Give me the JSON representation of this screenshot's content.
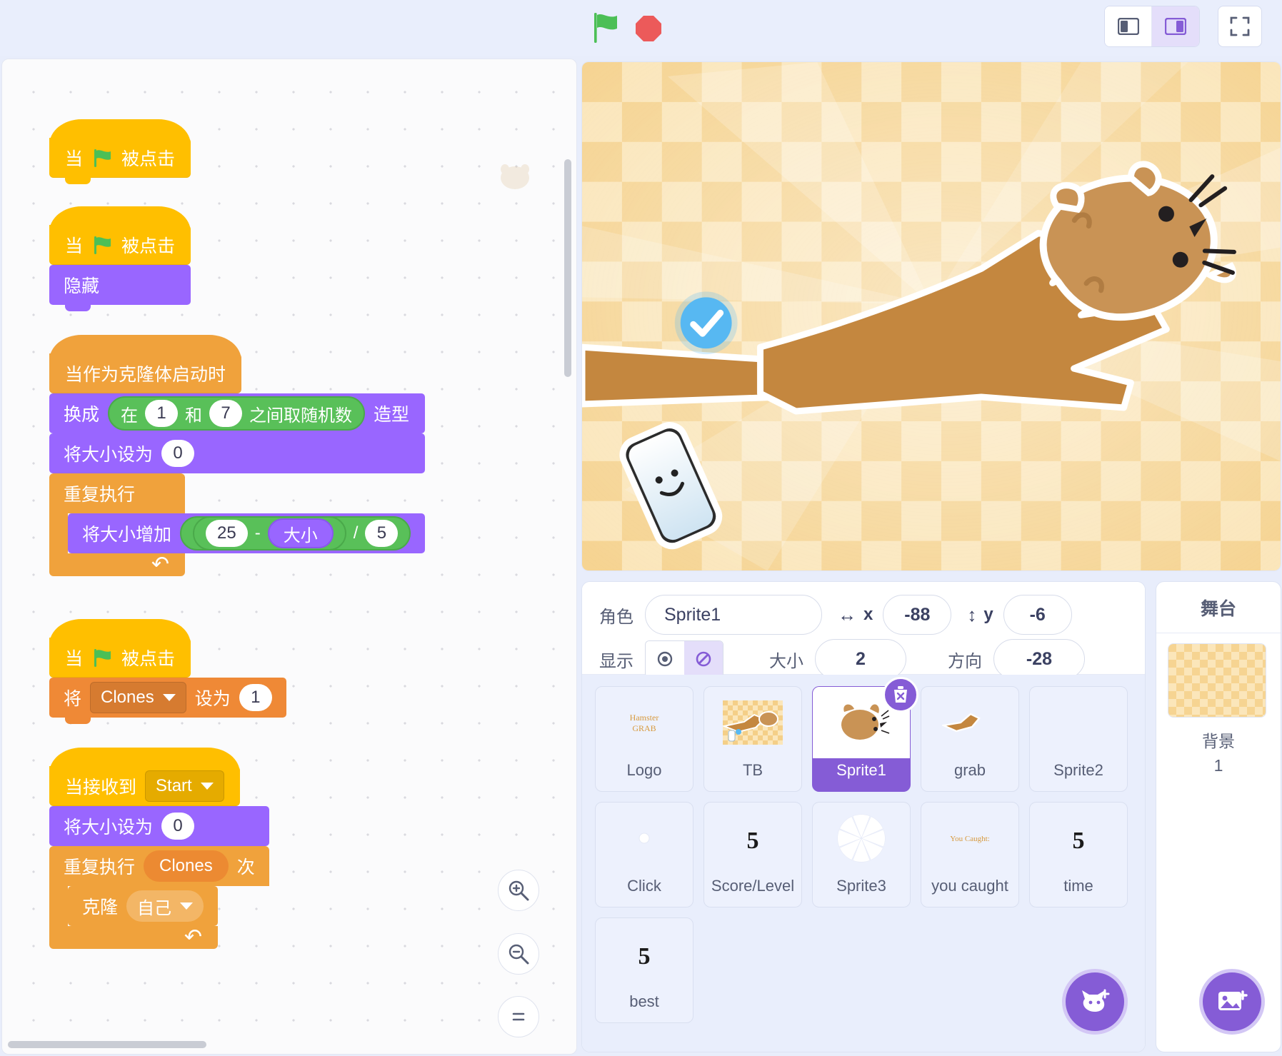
{
  "toolbar": {
    "green_flag_icon": "green-flag-icon",
    "stop_icon": "stop-sign-icon",
    "mode_small_icon": "small-stage-layout-icon",
    "mode_large_icon": "large-stage-layout-icon",
    "fullscreen_icon": "fullscreen-icon",
    "mode_selected": "large"
  },
  "code": {
    "zoom_in_icon": "zoom-in-icon",
    "zoom_out_icon": "zoom-out-icon",
    "zoom_reset_icon": "zoom-reset-icon",
    "scripts": [
      {
        "id": "script-flag-1",
        "hat": "当 ⚑ 被点击",
        "hat_pre": "当",
        "hat_post": "被点击"
      },
      {
        "id": "script-flag-hide",
        "hat_pre": "当",
        "hat_post": "被点击",
        "body_label": "隐藏"
      },
      {
        "id": "script-clone-start",
        "hat": "当作为克隆体启动时",
        "switch_costume_pre": "换成",
        "switch_costume_post": "造型",
        "random_pre": "在",
        "random_mid": "和",
        "random_post": "之间取随机数",
        "random_from": "1",
        "random_to": "7",
        "set_size_label": "将大小设为",
        "set_size_value": "0",
        "forever_label": "重复执行",
        "change_size_label": "将大小增加",
        "math_a": "25",
        "math_op1": "-",
        "math_var": "大小",
        "math_op2": "/",
        "math_b": "5"
      },
      {
        "id": "script-flag-set-clones",
        "hat_pre": "当",
        "hat_post": "被点击",
        "set_pre": "将",
        "set_var": "Clones",
        "set_mid": "设为",
        "set_value": "1"
      },
      {
        "id": "script-receive-start",
        "hat_pre": "当接收到",
        "message": "Start",
        "set_size_label": "将大小设为",
        "set_size_value": "0",
        "repeat_pre": "重复执行",
        "repeat_var": "Clones",
        "repeat_post": "次",
        "clone_pre": "克隆",
        "clone_target": "自己"
      }
    ]
  },
  "sprite_info": {
    "name_label": "角色",
    "name_value": "Sprite1",
    "x_label": "x",
    "x_value": "-88",
    "y_label": "y",
    "y_value": "-6",
    "show_label": "显示",
    "show_icon": "eye-visible-icon",
    "hide_icon": "eye-hidden-icon",
    "visible_selected": "hidden",
    "size_label": "大小",
    "size_value": "2",
    "direction_label": "方向",
    "direction_value": "-28",
    "x_axis_icon": "horizontal-arrows-icon",
    "y_axis_icon": "vertical-arrows-icon"
  },
  "sprites": [
    {
      "name": "Logo",
      "thumb": "hamster-grab-text",
      "selected": false
    },
    {
      "name": "TB",
      "thumb": "checker-hand-scene",
      "selected": false
    },
    {
      "name": "Sprite1",
      "thumb": "hamster",
      "selected": true
    },
    {
      "name": "grab",
      "thumb": "hand-grab",
      "selected": false
    },
    {
      "name": "Sprite2",
      "thumb": "blank",
      "selected": false
    },
    {
      "name": "Click",
      "thumb": "dot",
      "selected": false
    },
    {
      "name": "Score/Level",
      "thumb": "five",
      "selected": false
    },
    {
      "name": "Sprite3",
      "thumb": "pinwheel",
      "selected": false
    },
    {
      "name": "you caught",
      "thumb": "you-caught-text",
      "selected": false
    },
    {
      "name": "time",
      "thumb": "five",
      "selected": false
    },
    {
      "name": "best",
      "thumb": "five",
      "selected": false
    }
  ],
  "sprite_panel": {
    "add_sprite_icon": "add-sprite-cat-icon",
    "delete_icon": "trash-icon"
  },
  "stage_panel": {
    "header": "舞台",
    "backdrop_label": "背景",
    "backdrop_count": "1",
    "add_backdrop_icon": "add-backdrop-image-icon"
  },
  "colors": {
    "events": "#ffbf00",
    "control": "#f0a23c",
    "looks": "#9966ff",
    "variables": "#ef8936",
    "operators": "#59c059",
    "accent": "#855cd6",
    "panel_bg": "#e9eefc"
  }
}
